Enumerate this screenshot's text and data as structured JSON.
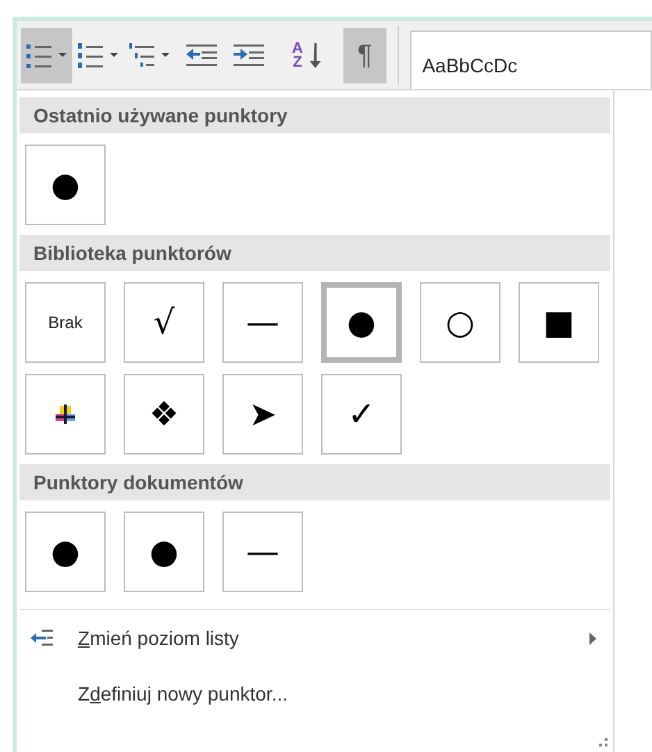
{
  "ribbon": {
    "buttons": [
      {
        "kind": "bullets",
        "pressed": true,
        "dropdown": true
      },
      {
        "kind": "numbering",
        "pressed": false,
        "dropdown": true
      },
      {
        "kind": "multilevel",
        "pressed": false,
        "dropdown": true
      },
      {
        "kind": "outdent",
        "pressed": false,
        "dropdown": false
      },
      {
        "kind": "indent",
        "pressed": false,
        "dropdown": false
      },
      {
        "kind": "sort",
        "pressed": false,
        "dropdown": false,
        "letters": [
          "A",
          "Z"
        ]
      },
      {
        "kind": "pilcrow",
        "pressed": true,
        "dropdown": false,
        "symbol": "¶"
      }
    ],
    "style_gallery": {
      "preview": "AaBbCcDc"
    }
  },
  "sections": [
    {
      "title": "Ostatnio używane punktory",
      "tiles": [
        {
          "kind": "glyph",
          "symbol": "●",
          "selected": false
        }
      ]
    },
    {
      "title": "Biblioteka punktorów",
      "tiles": [
        {
          "kind": "text",
          "label": "Brak",
          "selected": false
        },
        {
          "kind": "glyph",
          "symbol": "√",
          "selected": false
        },
        {
          "kind": "glyph",
          "symbol": "—",
          "selected": false
        },
        {
          "kind": "glyph",
          "symbol": "●",
          "selected": true
        },
        {
          "kind": "glyph",
          "symbol": "○",
          "selected": false
        },
        {
          "kind": "glyph",
          "symbol": "■",
          "selected": false
        },
        {
          "kind": "picture",
          "selected": false
        },
        {
          "kind": "glyph",
          "symbol": "❖",
          "selected": false
        },
        {
          "kind": "glyph",
          "symbol": "➤",
          "selected": false
        },
        {
          "kind": "glyph",
          "symbol": "✓",
          "selected": false
        }
      ]
    },
    {
      "title": "Punktory dokumentów",
      "tiles": [
        {
          "kind": "glyph",
          "symbol": "●",
          "selected": false
        },
        {
          "kind": "glyph",
          "symbol": "●",
          "selected": false
        },
        {
          "kind": "glyph",
          "symbol": "—",
          "selected": false
        }
      ]
    }
  ],
  "menu": [
    {
      "kind": "change-level",
      "access_key": "Z",
      "rest": "mień poziom listy",
      "submenu": true
    },
    {
      "kind": "define",
      "prefix": "Z",
      "access_key": "d",
      "rest": "efiniuj nowy punktor...",
      "submenu": false
    }
  ]
}
